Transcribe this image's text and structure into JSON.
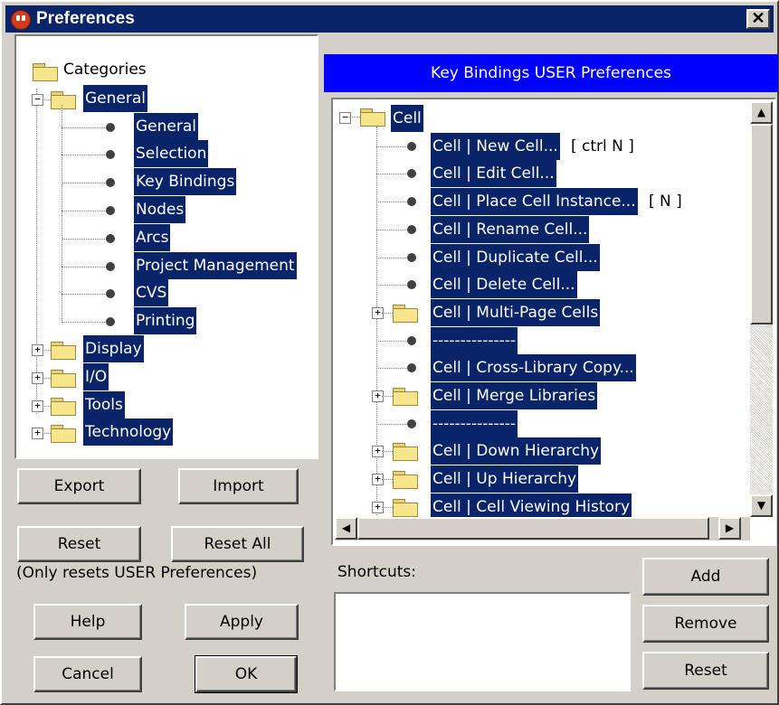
{
  "window": {
    "title": "Preferences",
    "close_glyph": "✕"
  },
  "left_tree": {
    "root": "Categories",
    "groups": [
      {
        "label": "General",
        "expanded": true,
        "children": [
          "General",
          "Selection",
          "Key Bindings",
          "Nodes",
          "Arcs",
          "Project Management",
          "CVS",
          "Printing"
        ]
      },
      {
        "label": "Display",
        "expanded": false
      },
      {
        "label": "I/O",
        "expanded": false
      },
      {
        "label": "Tools",
        "expanded": false
      },
      {
        "label": "Technology",
        "expanded": false
      }
    ],
    "selected": "Key Bindings"
  },
  "left_buttons": {
    "export": "Export",
    "import": "Import",
    "reset": "Reset",
    "reset_all": "Reset All",
    "reset_note": "(Only resets USER Preferences)",
    "help": "Help",
    "apply": "Apply",
    "cancel": "Cancel",
    "ok": "OK"
  },
  "panel": {
    "header": "Key Bindings USER Preferences"
  },
  "key_tree": {
    "root": "Cell",
    "items": [
      {
        "kind": "leaf",
        "label": "Cell | New Cell...",
        "shortcut": "[ ctrl N ]"
      },
      {
        "kind": "leaf",
        "label": "Cell | Edit Cell..."
      },
      {
        "kind": "leaf",
        "label": "Cell | Place Cell Instance...",
        "shortcut": "[ N ]"
      },
      {
        "kind": "leaf",
        "label": "Cell | Rename Cell..."
      },
      {
        "kind": "leaf",
        "label": "Cell | Duplicate Cell..."
      },
      {
        "kind": "leaf",
        "label": "Cell | Delete Cell..."
      },
      {
        "kind": "folder",
        "label": "Cell | Multi-Page Cells"
      },
      {
        "kind": "leaf",
        "label": "---------------"
      },
      {
        "kind": "leaf",
        "label": "Cell | Cross-Library Copy..."
      },
      {
        "kind": "folder",
        "label": "Cell | Merge Libraries"
      },
      {
        "kind": "leaf",
        "label": "---------------"
      },
      {
        "kind": "folder",
        "label": "Cell | Down Hierarchy"
      },
      {
        "kind": "folder",
        "label": "Cell | Up Hierarchy"
      },
      {
        "kind": "folder",
        "label": "Cell | Cell Viewing History"
      }
    ]
  },
  "shortcuts": {
    "label": "Shortcuts:",
    "value": "",
    "add": "Add",
    "remove": "Remove",
    "reset": "Reset"
  },
  "icons": {
    "folder": "folder-icon",
    "leaf": "bullet-icon",
    "expand": "+",
    "collapse": "−",
    "scroll_up": "▲",
    "scroll_down": "▼",
    "scroll_left": "◀",
    "scroll_right": "▶"
  },
  "colors": {
    "title_bar": "#0a246a",
    "header_bar": "#0000ff",
    "selection": "#0a246a",
    "face": "#d4d0c8"
  }
}
